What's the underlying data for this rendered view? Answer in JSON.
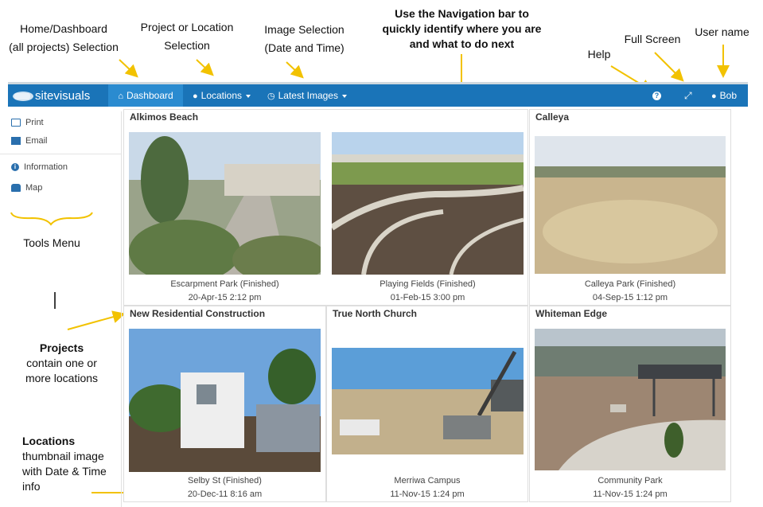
{
  "annotations": {
    "home_1": "Home/Dashboard",
    "home_2": "(all projects) Selection",
    "proj_1": "Project or Location",
    "proj_2": "Selection",
    "image_1": "Image Selection",
    "image_2": "(Date and Time)",
    "nav_1": "Use the Navigation bar to",
    "nav_2": "quickly identify where you are",
    "nav_3": "and what to do next",
    "help": "Help",
    "fullscreen": "Full Screen",
    "username": "User name",
    "tools": "Tools Menu",
    "projects_bold": "Projects",
    "projects_2": "contain one or",
    "projects_3": "more locations",
    "locations_bold": "Locations",
    "locations_2": "thumbnail image",
    "locations_3": "with Date & Time",
    "locations_4": "info",
    "accent_color": "#f2c200"
  },
  "navbar": {
    "logo_text": "sitevisuals",
    "dashboard": "Dashboard",
    "locations": "Locations",
    "latest_images": "Latest Images",
    "user": "Bob",
    "bar_color": "#1a74b8"
  },
  "sidebar": {
    "print": "Print",
    "email": "Email",
    "information": "Information",
    "map": "Map"
  },
  "projects": [
    {
      "title": "Alkimos Beach",
      "locations": [
        {
          "name": "Escarpment Park (Finished)",
          "date": "20-Apr-15 2:12 pm"
        },
        {
          "name": "Playing Fields (Finished)",
          "date": "01-Feb-15 3:00 pm"
        }
      ]
    },
    {
      "title": "Calleya",
      "locations": [
        {
          "name": "Calleya Park (Finished)",
          "date": "04-Sep-15 1:12 pm"
        }
      ]
    },
    {
      "title": "New Residential Construction",
      "locations": [
        {
          "name": "Selby St (Finished)",
          "date": "20-Dec-11 8:16 am"
        }
      ]
    },
    {
      "title": "True North Church",
      "locations": [
        {
          "name": "Merriwa Campus",
          "date": "11-Nov-15 1:24 pm"
        }
      ]
    },
    {
      "title": "Whiteman Edge",
      "locations": [
        {
          "name": "Community Park",
          "date": "11-Nov-15 1:24 pm"
        }
      ]
    }
  ]
}
